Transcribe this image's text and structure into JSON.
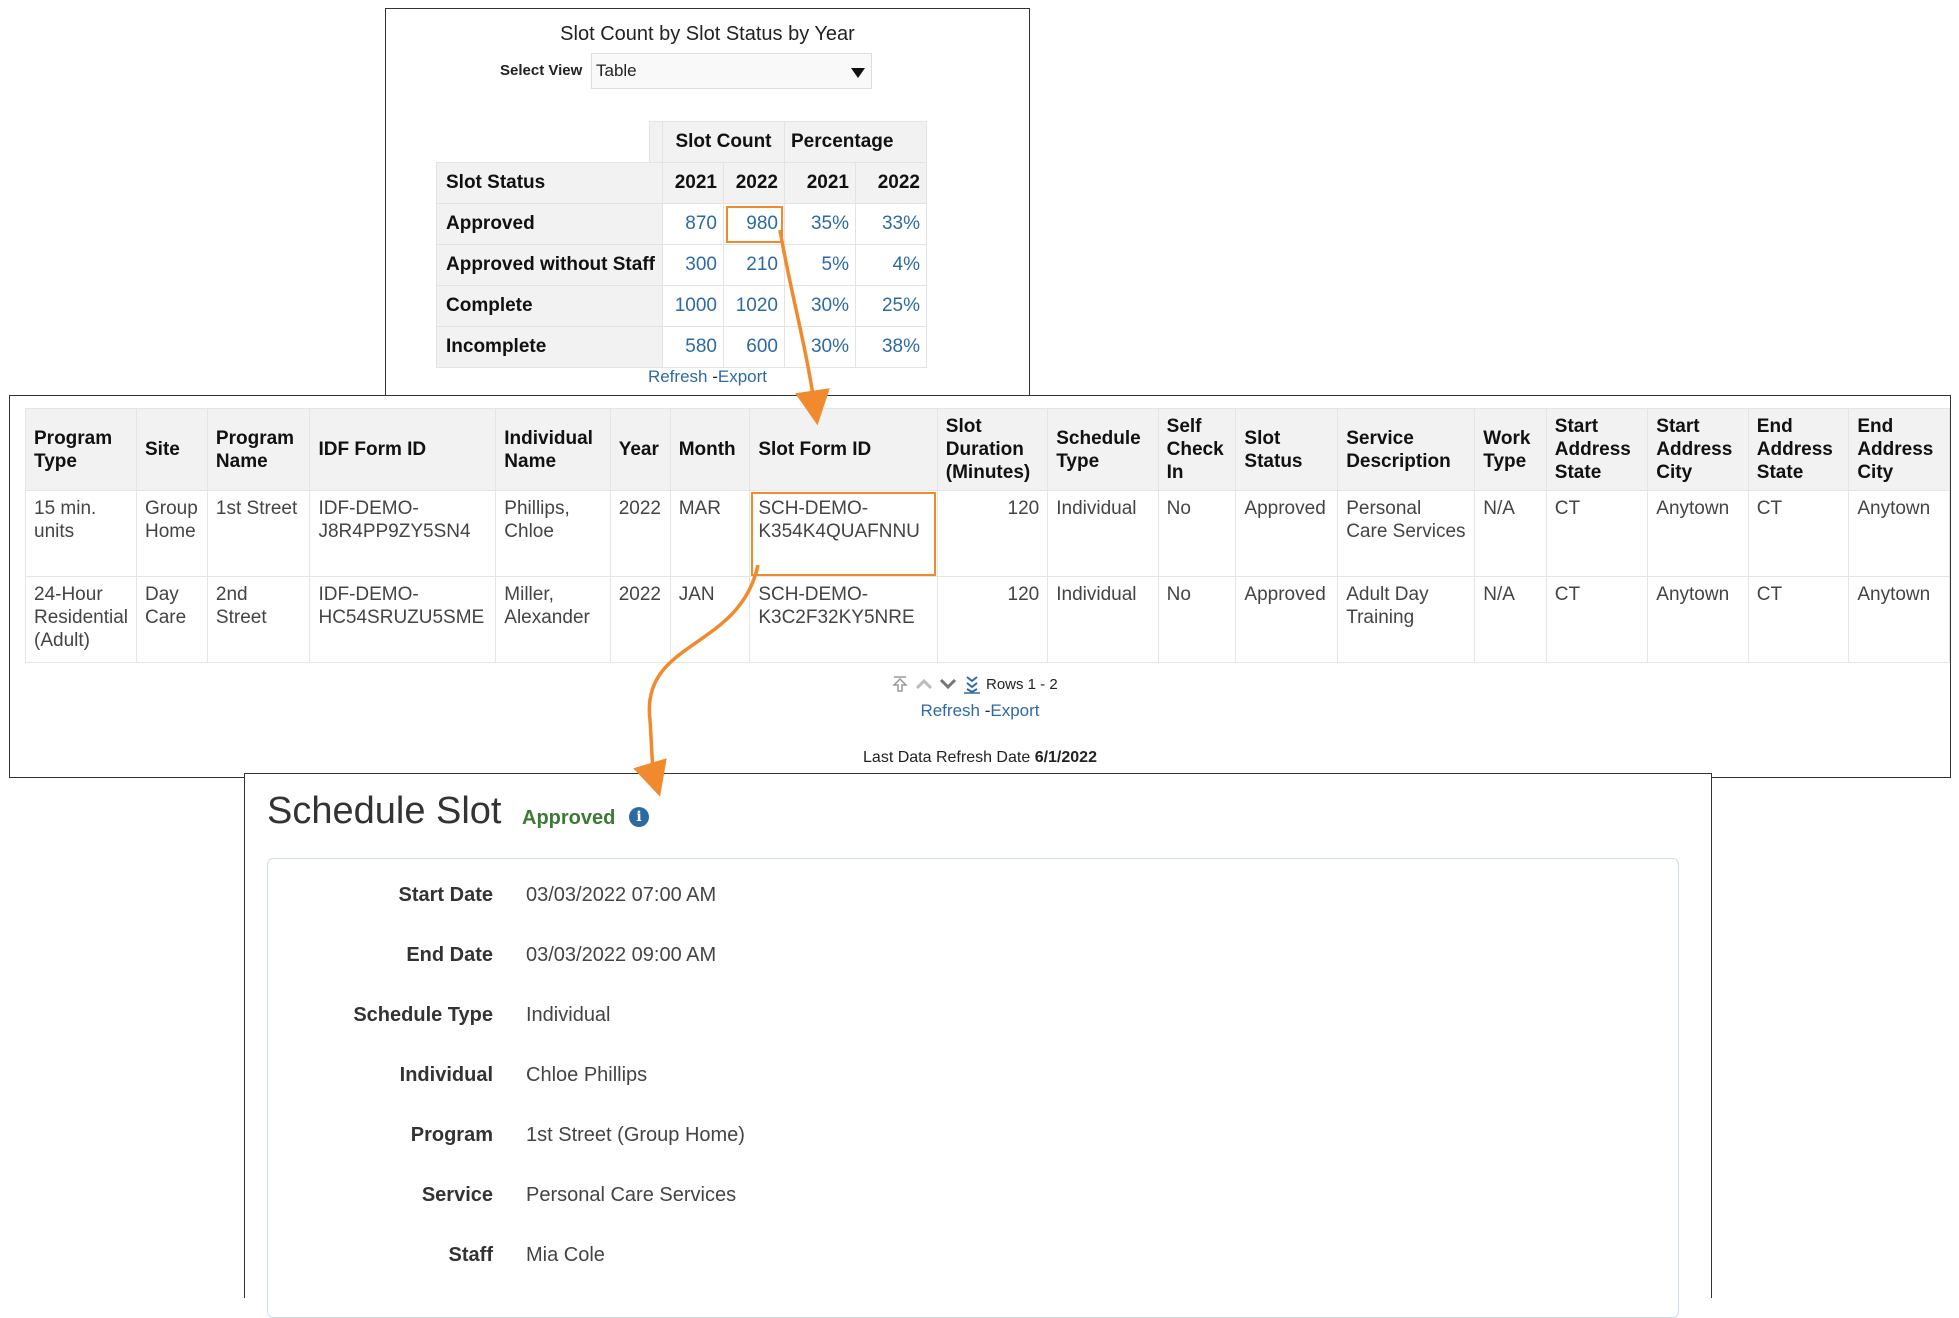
{
  "slot_count_view": {
    "title": "Slot Count by Slot Status by Year",
    "select_view_label": "Select View",
    "select_view_value": "Table",
    "header_slot_count": "Slot Count",
    "header_percentage": "Percentage",
    "row_header": "Slot Status",
    "years": [
      "2021",
      "2022",
      "2021",
      "2022"
    ],
    "rows": [
      {
        "status": "Approved",
        "values": [
          "870",
          "980",
          "35%",
          "33%"
        ]
      },
      {
        "status": "Approved without Staff",
        "values": [
          "300",
          "210",
          "5%",
          "4%"
        ]
      },
      {
        "status": "Complete",
        "values": [
          "1000",
          "1020",
          "30%",
          "25%"
        ]
      },
      {
        "status": "Incomplete",
        "values": [
          "580",
          "600",
          "30%",
          "38%"
        ]
      }
    ],
    "refresh_label": "Refresh",
    "export_label": "Export"
  },
  "slot_detail_table": {
    "columns": [
      "Program Type",
      "Site",
      "Program Name",
      "IDF Form ID",
      "Individual Name",
      "Year",
      "Month",
      "Slot Form ID",
      "Slot Duration (Minutes)",
      "Schedule Type",
      "Self Check In",
      "Slot Status",
      "Service Description",
      "Work Type",
      "Start Address State",
      "Start Address City",
      "End Address State",
      "End Address City"
    ],
    "rows": [
      [
        "15 min. units",
        "Group Home",
        "1st Street",
        "IDF-DEMO-J8R4PP9ZY5SN4",
        "Phillips, Chloe",
        "2022",
        "MAR",
        "SCH-DEMO-K354K4QUAFNNU",
        "120",
        "Individual",
        "No",
        "Approved",
        "Personal Care Services",
        "N/A",
        "CT",
        "Anytown",
        "CT",
        "Anytown"
      ],
      [
        "24-Hour Residential (Adult)",
        "Day Care",
        "2nd Street",
        "IDF-DEMO-HC54SRUZU5SME",
        "Miller, Alexander",
        "2022",
        "JAN",
        "SCH-DEMO-K3C2F32KY5NRE",
        "120",
        "Individual",
        "No",
        "Approved",
        "Adult Day Training",
        "N/A",
        "CT",
        "Anytown",
        "CT",
        "Anytown"
      ]
    ],
    "rows_label": "Rows 1 - 2",
    "refresh_label": "Refresh",
    "export_label": "Export",
    "last_refresh_label": "Last Data Refresh Date",
    "last_refresh_date": "6/1/2022"
  },
  "schedule_slot": {
    "title": "Schedule Slot",
    "status": "Approved",
    "fields": [
      {
        "label": "Start Date",
        "value": "03/03/2022 07:00 AM"
      },
      {
        "label": "End Date",
        "value": "03/03/2022 09:00 AM"
      },
      {
        "label": "Schedule Type",
        "value": "Individual"
      },
      {
        "label": "Individual",
        "value": "Chloe Phillips"
      },
      {
        "label": "Program",
        "value": "1st Street (Group Home)"
      },
      {
        "label": "Service",
        "value": "Personal Care Services"
      },
      {
        "label": "Staff",
        "value": "Mia Cole"
      }
    ]
  },
  "colors": {
    "link": "#2d6aa3",
    "highlight": "#f08a2c",
    "approved": "#3c7a35"
  }
}
